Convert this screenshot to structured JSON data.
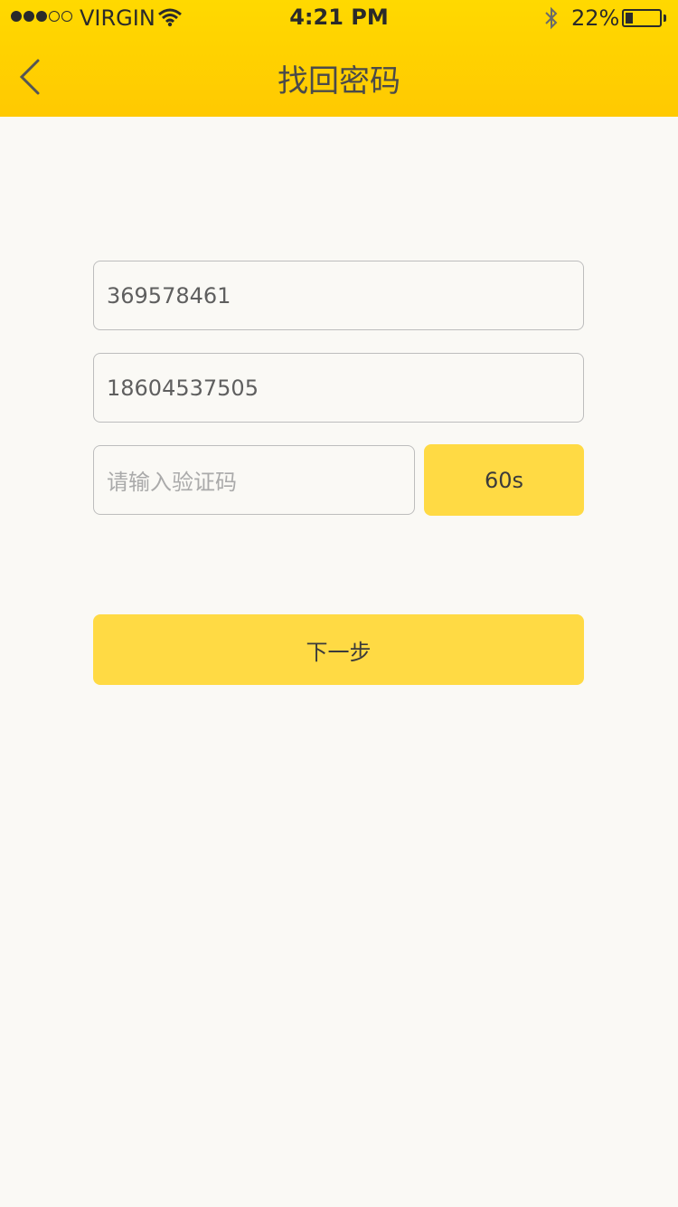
{
  "status_bar": {
    "carrier": "VIRGIN",
    "time": "4:21 PM",
    "battery_percent": "22%",
    "battery_level": 0.22,
    "signal_bars_filled": 3,
    "signal_bars_total": 5
  },
  "nav": {
    "title": "找回密码",
    "back_icon": "chevron-left-icon"
  },
  "form": {
    "account_value": "369578461",
    "phone_value": "18604537505",
    "code_placeholder": "请输入验证码",
    "timer_label": "60s",
    "next_label": "下一步"
  },
  "colors": {
    "header": "#FFD300",
    "button": "#FFDA44",
    "background": "#FAF9F5"
  }
}
